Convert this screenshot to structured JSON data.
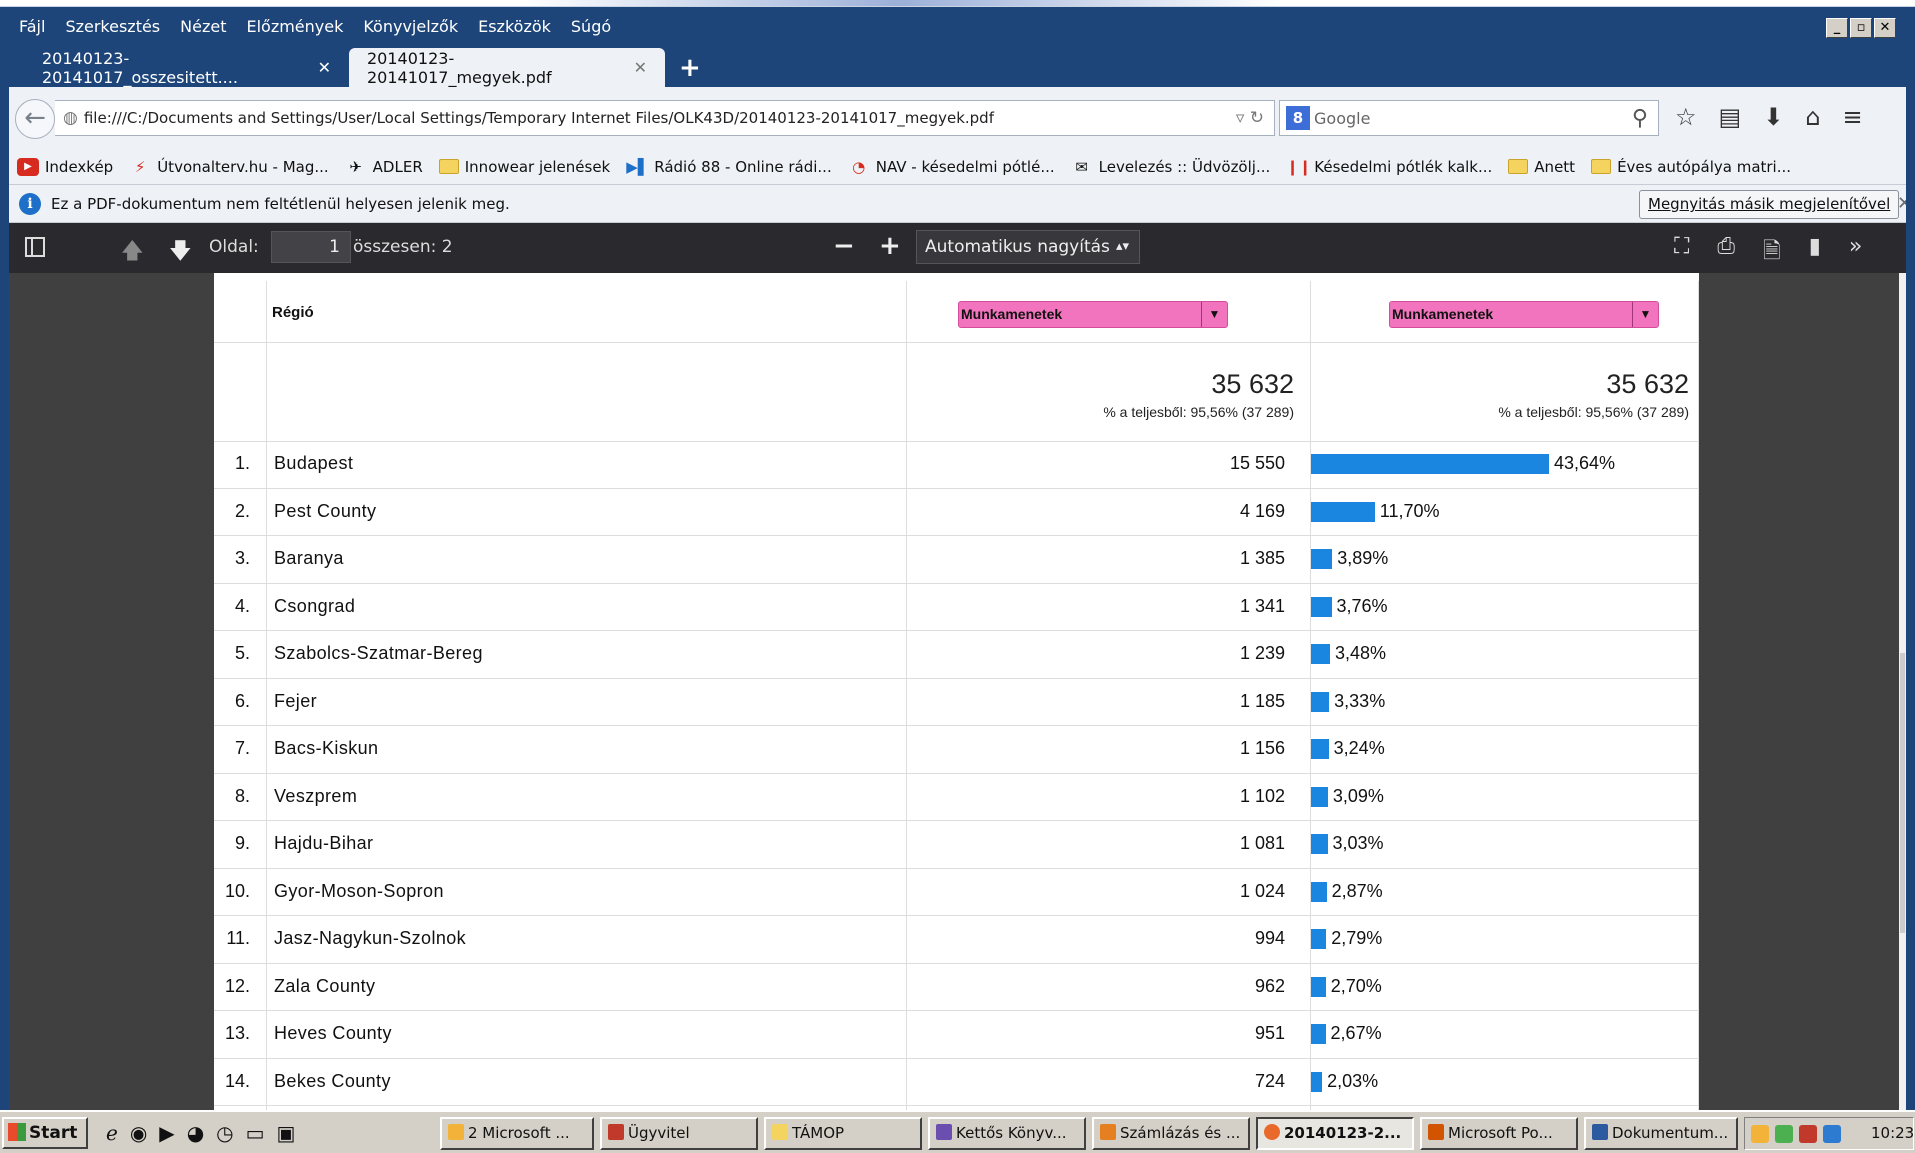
{
  "menu": {
    "items": [
      "Fájl",
      "Szerkesztés",
      "Nézet",
      "Előzmények",
      "Könyvjelzők",
      "Eszközök",
      "Súgó"
    ]
  },
  "tabs": [
    {
      "label": "20140123-20141017_osszesitett....",
      "close": "✕"
    },
    {
      "label": "20140123-20141017_megyek.pdf",
      "close": "✕"
    }
  ],
  "newtab_symbol": "+",
  "nav": {
    "url": "file:///C:/Documents and Settings/User/Local Settings/Temporary Internet Files/OLK43D/20140123-20141017_megyek.pdf",
    "search_placeholder": "Google",
    "search_engine_badge": "8"
  },
  "bookmarks": [
    {
      "icon": "youtube-icon",
      "label": "Indexkép"
    },
    {
      "icon": "route-icon",
      "label": "Útvonalterv.hu - Mag..."
    },
    {
      "icon": "adler-icon",
      "label": "ADLER"
    },
    {
      "icon": "folder-icon",
      "label": "Innowear jelenések"
    },
    {
      "icon": "radio-icon",
      "label": "Rádió 88 - Online rádi..."
    },
    {
      "icon": "nav-icon",
      "label": "NAV - késedelmi pótlé..."
    },
    {
      "icon": "mail-icon",
      "label": "Levelezés :: Üdvözölj..."
    },
    {
      "icon": "calc-icon",
      "label": "Késedelmi pótlék kalk..."
    },
    {
      "icon": "folder-icon",
      "label": "Anett"
    },
    {
      "icon": "folder-icon",
      "label": "Éves autópálya matri..."
    }
  ],
  "notice": {
    "message": "Ez a PDF-dokumentum nem feltétlenül helyesen jelenik meg.",
    "button": "Megnyitás másik megjelenítővel"
  },
  "pdf_toolbar": {
    "page_label": "Oldal:",
    "page_value": "1",
    "total_label": "összesen: 2",
    "zoom_label": "Automatikus nagyítás"
  },
  "report": {
    "region_header": "Régió",
    "metric1": "Munkamenetek",
    "metric2": "Munkamenetek",
    "total_value": "35 632",
    "total_sub": "% a teljesből: 95,56% (37 289)"
  },
  "chart_data": {
    "type": "bar",
    "title": "",
    "categories": [
      "Budapest",
      "Pest County",
      "Baranya",
      "Csongrad",
      "Szabolcs-Szatmar-Bereg",
      "Fejer",
      "Bacs-Kiskun",
      "Veszprem",
      "Hajdu-Bihar",
      "Gyor-Moson-Sopron",
      "Jasz-Nagykun-Szolnok",
      "Zala County",
      "Heves County",
      "Bekes County"
    ],
    "values": [
      15550,
      4169,
      1385,
      1341,
      1239,
      1185,
      1156,
      1102,
      1081,
      1024,
      994,
      962,
      951,
      724
    ],
    "value_labels": [
      "15 550",
      "4 169",
      "1 385",
      "1 341",
      "1 239",
      "1 185",
      "1 156",
      "1 102",
      "1 081",
      "1 024",
      "994",
      "962",
      "951",
      "724"
    ],
    "percent": [
      43.64,
      11.7,
      3.89,
      3.76,
      3.48,
      3.33,
      3.24,
      3.09,
      3.03,
      2.87,
      2.79,
      2.7,
      2.67,
      2.03
    ],
    "percent_labels": [
      "43,64%",
      "11,70%",
      "3,89%",
      "3,76%",
      "3,48%",
      "3,33%",
      "3,24%",
      "3,09%",
      "3,03%",
      "2,87%",
      "2,79%",
      "2,70%",
      "2,67%",
      "2,03%"
    ],
    "indices": [
      "1.",
      "2.",
      "3.",
      "4.",
      "5.",
      "6.",
      "7.",
      "8.",
      "9.",
      "10.",
      "11.",
      "12.",
      "13.",
      "14."
    ],
    "bar_color": "#1b86e0"
  },
  "taskbar": {
    "start": "Start",
    "buttons": [
      "2 Microsoft ...",
      "Ügyvitel",
      "TÁMOP",
      "Kettős Könyv...",
      "Számlázás és ...",
      "20140123-2...",
      "Microsoft Po...",
      "Dokumentum..."
    ],
    "clock": "10:23"
  }
}
